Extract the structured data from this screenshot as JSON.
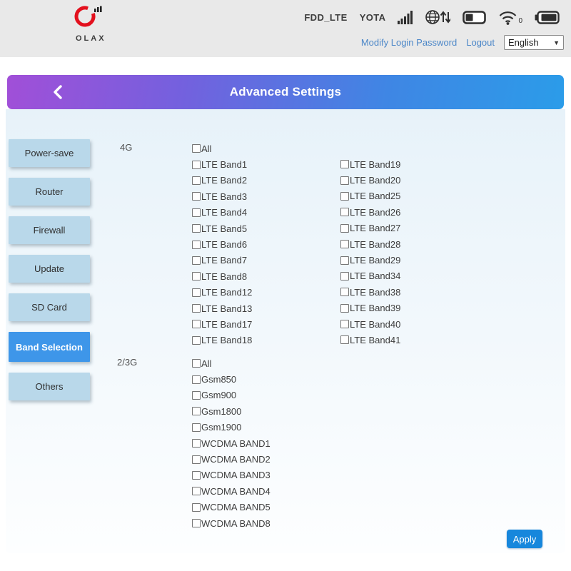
{
  "topbar": {
    "brand": "OLAX",
    "status": {
      "network_mode": "FDD_LTE",
      "operator": "YOTA",
      "wifi_clients": "0"
    },
    "links": {
      "modify_password": "Modify Login Password",
      "logout": "Logout"
    },
    "language": {
      "selected": "English"
    }
  },
  "header": {
    "title": "Advanced Settings"
  },
  "sidebar": {
    "items": [
      {
        "label": "Power-save"
      },
      {
        "label": "Router"
      },
      {
        "label": "Firewall"
      },
      {
        "label": "Update"
      },
      {
        "label": "SD Card"
      },
      {
        "label": "Band Selection",
        "active": true
      },
      {
        "label": "Others"
      }
    ]
  },
  "band_selection": {
    "sections": [
      {
        "label": "4G",
        "columns": [
          [
            "All",
            "LTE Band1",
            "LTE Band2",
            "LTE Band3",
            "LTE Band4",
            "LTE Band5",
            "LTE Band6",
            "LTE Band7",
            "LTE Band8",
            "LTE Band12",
            "LTE Band13",
            "LTE Band17",
            "LTE Band18"
          ],
          [
            "LTE Band19",
            "LTE Band20",
            "LTE Band25",
            "LTE Band26",
            "LTE Band27",
            "LTE Band28",
            "LTE Band29",
            "LTE Band34",
            "LTE Band38",
            "LTE Band39",
            "LTE Band40",
            "LTE Band41"
          ]
        ]
      },
      {
        "label": "2/3G",
        "columns": [
          [
            "All",
            "Gsm850",
            "Gsm900",
            "Gsm1800",
            "Gsm1900",
            "WCDMA BAND1",
            "WCDMA BAND2",
            "WCDMA BAND3",
            "WCDMA BAND4",
            "WCDMA BAND5",
            "WCDMA BAND8"
          ]
        ]
      }
    ],
    "checkboxes_checked": false,
    "apply_label": "Apply"
  },
  "colors": {
    "topbar_bg": "#e9e9e9",
    "header_gradient_start": "#a14fd8",
    "header_gradient_end": "#2b9ce9",
    "sidebar_button": "#b9d8ea",
    "sidebar_active": "#3e96e9",
    "apply_button": "#1787dc",
    "link_blue": "#4c87c8",
    "logo_red": "#e3101d"
  }
}
